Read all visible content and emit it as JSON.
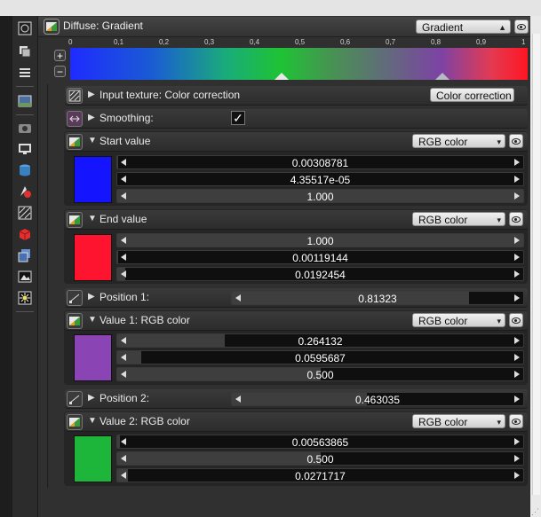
{
  "header": {
    "title": "Diffuse: Gradient",
    "type_select": "Gradient",
    "type_select_icon": "chevron-updown-icon"
  },
  "gradient": {
    "ticks": [
      "0",
      "0,1",
      "0,2",
      "0,3",
      "0,4",
      "0,5",
      "0,6",
      "0,7",
      "0,8",
      "0,9",
      "1"
    ],
    "colors": [
      "#1f2bff",
      "#1ec334",
      "#7c43a4",
      "#ff1622"
    ],
    "marker_positions": [
      0.463035,
      0.81323
    ],
    "add_button": "+",
    "remove_button": "−"
  },
  "input_texture": {
    "label": "Input texture: Color correction",
    "select": "Color correction"
  },
  "smoothing": {
    "label": "Smoothing:",
    "checked": true,
    "check_glyph": "✓"
  },
  "start_value": {
    "label": "Start value",
    "select": "RGB color",
    "color": "#1414ff",
    "values": [
      "0.00308781",
      "4.35517e-05",
      "1.000"
    ],
    "fractions": [
      0.00308781,
      4.35517e-05,
      1.0
    ]
  },
  "end_value": {
    "label": "End value",
    "select": "RGB color",
    "color": "#ff1430",
    "values": [
      "1.000",
      "0.00119144",
      "0.0192454"
    ],
    "fractions": [
      1.0,
      0.00119144,
      0.0192454
    ]
  },
  "position1": {
    "label": "Position 1:",
    "value": "0.81323",
    "fraction": 0.81323
  },
  "value1": {
    "label": "Value 1: RGB color",
    "select": "RGB color",
    "color": "#8a44b4",
    "values": [
      "0.264132",
      "0.0595687",
      "0.500"
    ],
    "fractions": [
      0.264132,
      0.0595687,
      0.5
    ]
  },
  "position2": {
    "label": "Position 2:",
    "value": "0.463035",
    "fraction": 0.463035
  },
  "value2": {
    "label": "Value 2: RGB color",
    "select": "RGB color",
    "color": "#1db53a",
    "values": [
      "0.00563865",
      "0.500",
      "0.0271717"
    ],
    "fractions": [
      0.00563865,
      0.5,
      0.0271717
    ]
  }
}
